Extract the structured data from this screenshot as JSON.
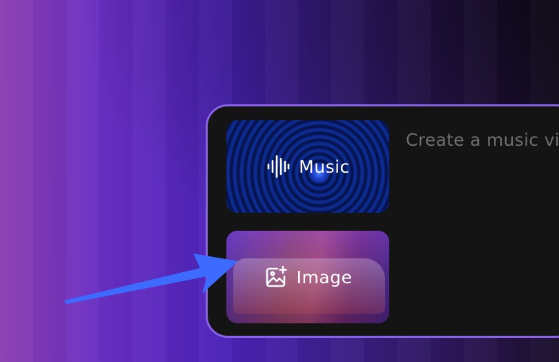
{
  "panel": {
    "cards": [
      {
        "label": "Music",
        "icon": "waveform-icon"
      },
      {
        "label": "Image",
        "icon": "image-add-icon"
      }
    ],
    "prompt_placeholder": "Create a music vi"
  },
  "colors": {
    "panel_border": "#8a63e6",
    "panel_bg": "#141414",
    "arrow": "#3d6bff",
    "prompt_text": "#6f6f6f"
  }
}
